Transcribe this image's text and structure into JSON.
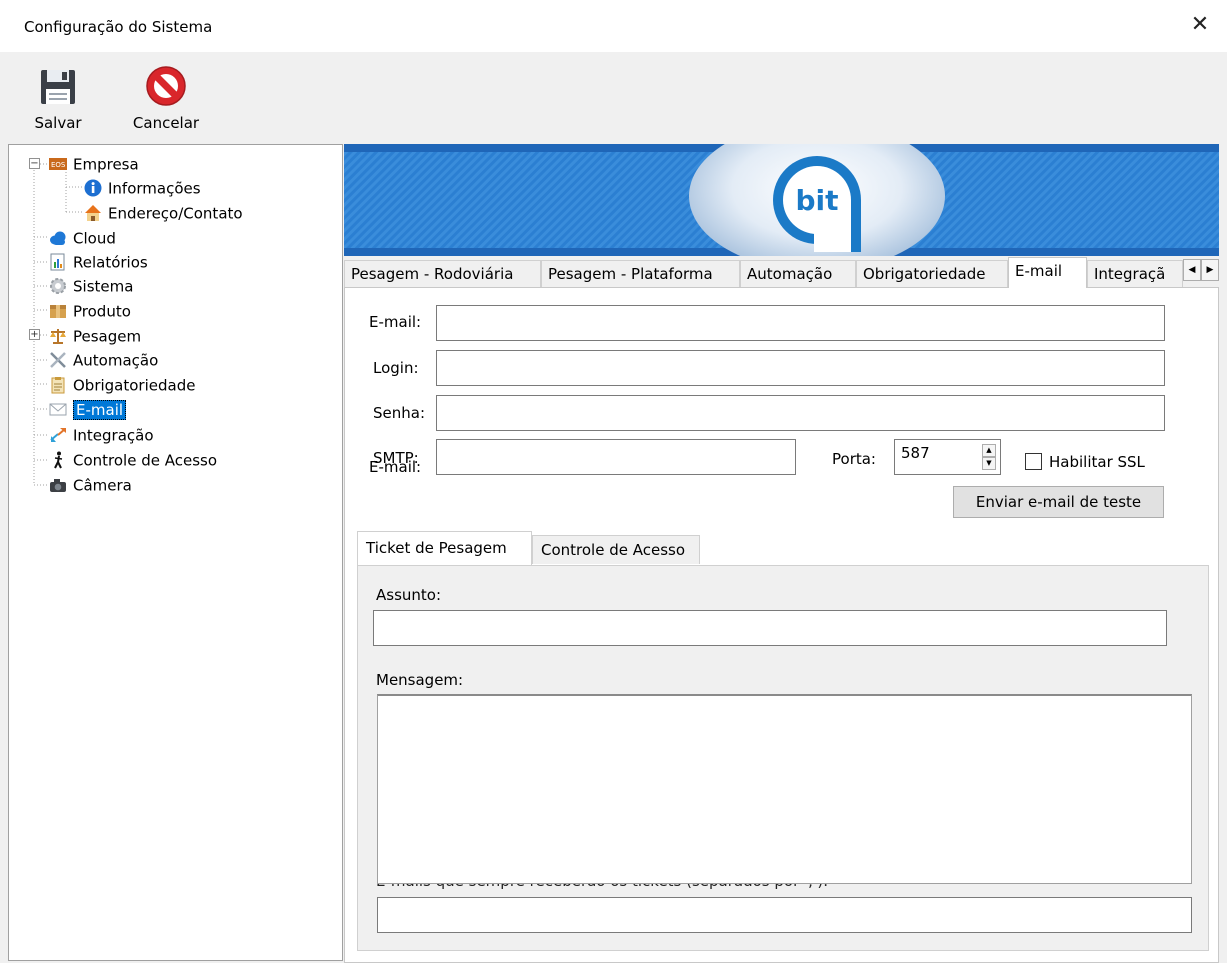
{
  "window": {
    "title": "Configuração do Sistema"
  },
  "toolbar": {
    "save_label": "Salvar",
    "cancel_label": "Cancelar"
  },
  "tree": {
    "items": [
      {
        "label": "Empresa",
        "icon": "company-icon"
      },
      {
        "label": "Informações",
        "icon": "info-icon"
      },
      {
        "label": "Endereço/Contato",
        "icon": "house-icon"
      },
      {
        "label": "Cloud",
        "icon": "cloud-icon"
      },
      {
        "label": "Relatórios",
        "icon": "report-icon"
      },
      {
        "label": "Sistema",
        "icon": "gear-icon"
      },
      {
        "label": "Produto",
        "icon": "box-icon"
      },
      {
        "label": "Pesagem",
        "icon": "scale-icon"
      },
      {
        "label": "Automação",
        "icon": "tools-icon"
      },
      {
        "label": "Obrigatoriedade",
        "icon": "clipboard-icon"
      },
      {
        "label": "E-mail",
        "icon": "envelope-icon"
      },
      {
        "label": "Integração",
        "icon": "arrows-icon"
      },
      {
        "label": "Controle de Acesso",
        "icon": "person-walking-icon"
      },
      {
        "label": "Câmera",
        "icon": "camera-icon"
      }
    ],
    "selected": "E-mail"
  },
  "banner": {
    "logo_text": "bit"
  },
  "tabs": [
    {
      "label": "Pesagem - Rodoviária"
    },
    {
      "label": "Pesagem - Plataforma"
    },
    {
      "label": "Automação"
    },
    {
      "label": "Obrigatoriedade"
    },
    {
      "label": "E-mail"
    },
    {
      "label": "Integraçã"
    }
  ],
  "email_form": {
    "email_label": "E-mail:",
    "email_value": "",
    "login_label": "Login:",
    "login_value": "",
    "password_label": "Senha:",
    "password_value": "",
    "smtp_label": "SMTP:",
    "smtp_value": "",
    "port_label": "Porta:",
    "port_value": "587",
    "ssl_label": "Habilitar SSL",
    "ssl_checked": false,
    "test_button": "Enviar e-mail de teste"
  },
  "subtabs": [
    {
      "label": "Ticket de Pesagem"
    },
    {
      "label": "Controle de Acesso"
    }
  ],
  "ticket": {
    "subject_label": "Assunto:",
    "subject_value": "",
    "message_label": "Mensagem:",
    "message_value": "",
    "recipients_label": "E-mails que sempre receberão os tickets (separados por ';'):",
    "recipients_value": ""
  },
  "colors": {
    "selection": "#0078d7",
    "banner": "#2a7fd4",
    "cancel_red": "#d9262b"
  }
}
